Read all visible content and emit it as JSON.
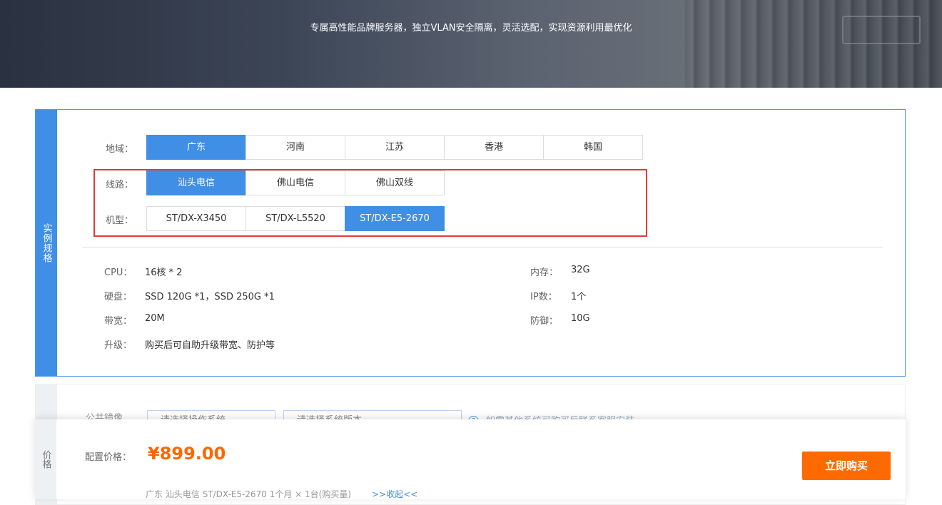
{
  "banner": {
    "tagline": "专属高性能品牌服务器，独立VLAN安全隔离，灵活选配，实现资源利用最优化"
  },
  "spec_panel": {
    "side_label": "实例规格",
    "region": {
      "label": "地域：",
      "options": [
        "广东",
        "河南",
        "江苏",
        "香港",
        "韩国"
      ],
      "selected": "广东"
    },
    "line": {
      "label": "线路：",
      "options": [
        "汕头电信",
        "佛山电信",
        "佛山双线"
      ],
      "selected": "汕头电信"
    },
    "model": {
      "label": "机型：",
      "options": [
        "ST/DX-X3450",
        "ST/DX-L5520",
        "ST/DX-E5-2670"
      ],
      "selected": "ST/DX-E5-2670"
    },
    "specs": {
      "cpu": {
        "key": "CPU：",
        "value": "16核 *  2"
      },
      "memory": {
        "key": "内存：",
        "value": "32G"
      },
      "disk": {
        "key": "硬盘：",
        "value": "SSD 120G *1，SSD 250G *1"
      },
      "ip": {
        "key": "IP数：",
        "value": "1个"
      },
      "bandwidth": {
        "key": "带宽：",
        "value": "20M"
      },
      "defense": {
        "key": "防御：",
        "value": "10G"
      },
      "upgrade": {
        "key": "升级：",
        "value": "购买后可自助升级带宽、防护等"
      }
    }
  },
  "price_panel": {
    "faded_label": "公共镜像",
    "faded_select_1": "请选择操作系统",
    "faded_select_2": "请选择系统版本",
    "faded_hint": "如需其他系统可购买后联系客服安装"
  },
  "footer": {
    "side_label": "价格",
    "price_label": "配置价格：",
    "price": "¥899.00",
    "summary": "广东  汕头电信  ST/DX-E5-2670  1个月 × 1台(购买量)",
    "collapse_link": ">>收起<<",
    "buy_label": "立即购买"
  },
  "colors": {
    "accent": "#3f8fe6",
    "price": "#ff6600",
    "buy": "#ff6a00",
    "highlight": "#e23a3a"
  }
}
